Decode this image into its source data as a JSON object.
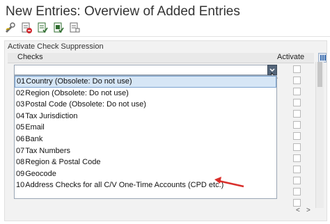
{
  "window": {
    "title": "New Entries: Overview of Added Entries"
  },
  "toolbar": {
    "buttons": [
      {
        "name": "display-change-icon"
      },
      {
        "name": "delete-icon"
      },
      {
        "name": "select-all-icon"
      },
      {
        "name": "select-block-icon"
      },
      {
        "name": "deselect-all-icon"
      }
    ]
  },
  "panel": {
    "title": "Activate Check Suppression",
    "columns": {
      "checks": "Checks",
      "activate": "Activate"
    }
  },
  "dropdown": {
    "options": [
      {
        "code": "01",
        "label": "Country (Obsolete: Do not use)",
        "selected": true
      },
      {
        "code": "02",
        "label": "Region (Obsolete: Do not use)",
        "selected": false
      },
      {
        "code": "03",
        "label": "Postal Code (Obsolete: Do not use)",
        "selected": false
      },
      {
        "code": "04",
        "label": "Tax Jurisdiction",
        "selected": false
      },
      {
        "code": "05",
        "label": "Email",
        "selected": false
      },
      {
        "code": "06",
        "label": "Bank",
        "selected": false
      },
      {
        "code": "07",
        "label": "Tax Numbers",
        "selected": false
      },
      {
        "code": "08",
        "label": "Region & Postal Code",
        "selected": false
      },
      {
        "code": "09",
        "label": "Geocode",
        "selected": false
      },
      {
        "code": "10",
        "label": "Address Checks for all C/V One-Time Accounts (CPD etc.)",
        "selected": false
      }
    ]
  },
  "scroll": {
    "left": "<",
    "right": ">"
  },
  "colors": {
    "selection_bg": "#d6e6f6",
    "annotation_arrow": "#d9302c",
    "dropdown_button": "#55667a"
  }
}
